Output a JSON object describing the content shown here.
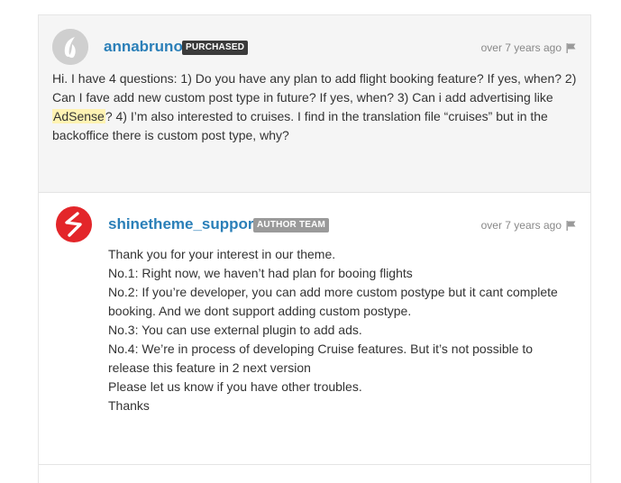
{
  "question": {
    "username": "annabruno",
    "badge": "PURCHASED",
    "time": "over 7 years ago",
    "text_before": "Hi. I have 4 questions: 1) Do you have any plan to add flight booking feature? If yes, when? 2) Can I fave add new custom post type in future? If yes, when? 3) Can i add advertising like ",
    "highlight": "AdSense",
    "text_after": "? 4) I’m also interested to cruises. I find in the translation file “cruises” but in the backoffice there is custom post type, why?"
  },
  "reply": {
    "username": "shinetheme_support",
    "badge": "AUTHOR TEAM",
    "time": "over 7 years ago",
    "lines": [
      "Thank you for your interest in our theme.",
      "No.1: Right now, we haven’t had plan for booing flights",
      "No.2: If you’re developer, you can add more custom postype but it cant complete booking. And we dont support adding custom postype.",
      "No.3: You can use external plugin to add ads.",
      "No.4: We’re in process of developing Cruise features. But it’s not possible to release this feature in 2 next version",
      "Please let us know if you have other troubles.",
      "Thanks"
    ]
  },
  "icons": {
    "question_avatar": "envato-leaf-avatar",
    "reply_avatar": "shinetheme-logo-avatar",
    "report": "flag-icon"
  },
  "colors": {
    "username": "#2a7fb8",
    "badge_purchased": "#3b3b3b",
    "badge_author": "#9a9a9a",
    "highlight": "#fff3b3",
    "logo_red": "#e3262a"
  }
}
